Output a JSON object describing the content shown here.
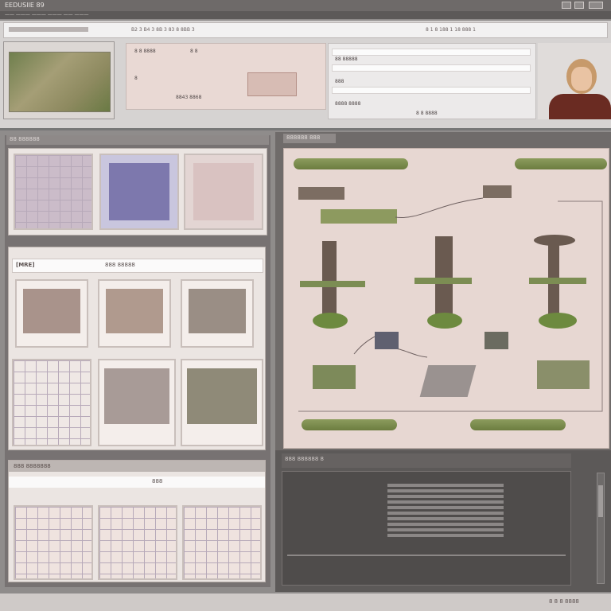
{
  "window": {
    "title": "EEDUSIIE 89",
    "menu_text": "—— ——— ——— ——— —— ———"
  },
  "address": {
    "tabs_text": "B2 3 B4 3 8B 3 83 8 8BB 3",
    "crumbs_text": "8 1 8 188 1 18 888 1"
  },
  "top_panel": {
    "label_a": "8 8 8888",
    "label_b": "8 8",
    "label_c": "8",
    "btn": "8843 8868",
    "mid_label": "8 8 8888"
  },
  "form": {
    "row1": "88 88888",
    "row2": "888",
    "row3": "8888 8888",
    "btn": "8 8 8888"
  },
  "status_bottom": "8 8 8888",
  "left_panel": {
    "header": "88 888888",
    "section_title": "[MRE]",
    "section_sub": "888 88888",
    "bottom_header": "888 8888888",
    "bottom_sub": "888"
  },
  "diagram": {
    "header": "888888 888"
  },
  "console": {
    "header": "888 888888 8"
  },
  "footer": {
    "text": "8 8 8 8888"
  }
}
